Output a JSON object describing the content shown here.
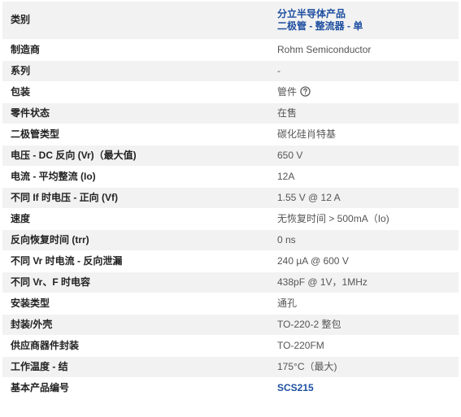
{
  "rows": [
    {
      "label": "类别",
      "value_links": [
        "分立半导体产品",
        "二极管 - 整流器 - 单"
      ]
    },
    {
      "label": "制造商",
      "value": "Rohm Semiconductor"
    },
    {
      "label": "系列",
      "value": "-"
    },
    {
      "label": "包装",
      "value": "管件",
      "icon": "help-circle-icon"
    },
    {
      "label": "零件状态",
      "value": "在售"
    },
    {
      "label": "二极管类型",
      "value": "碳化硅肖特基"
    },
    {
      "label": "电压 - DC 反向 (Vr)（最大值)",
      "value": "650 V"
    },
    {
      "label": "电流 - 平均整流 (Io)",
      "value": "12A"
    },
    {
      "label": "不同 If 时电压 - 正向 (Vf)",
      "value": "1.55 V @ 12 A"
    },
    {
      "label": "速度",
      "value": "无恢复时间 > 500mA（Io)"
    },
    {
      "label": "反向恢复时间 (trr)",
      "value": "0 ns"
    },
    {
      "label": "不同 Vr 时电流 - 反向泄漏",
      "value": "240 µA @ 600 V"
    },
    {
      "label": "不同 Vr、F 时电容",
      "value": "438pF @ 1V，1MHz"
    },
    {
      "label": "安装类型",
      "value": "通孔"
    },
    {
      "label": "封装/外壳",
      "value": "TO-220-2 整包"
    },
    {
      "label": "供应商器件封装",
      "value": "TO-220FM"
    },
    {
      "label": "工作温度 - 结",
      "value": "175°C（最大)"
    },
    {
      "label": "基本产品编号",
      "value_link": "SCS215"
    }
  ],
  "colors": {
    "stripe": "#f2f2f2",
    "link": "#1e4fa0",
    "label_text": "#222222",
    "value_text": "#555555"
  }
}
